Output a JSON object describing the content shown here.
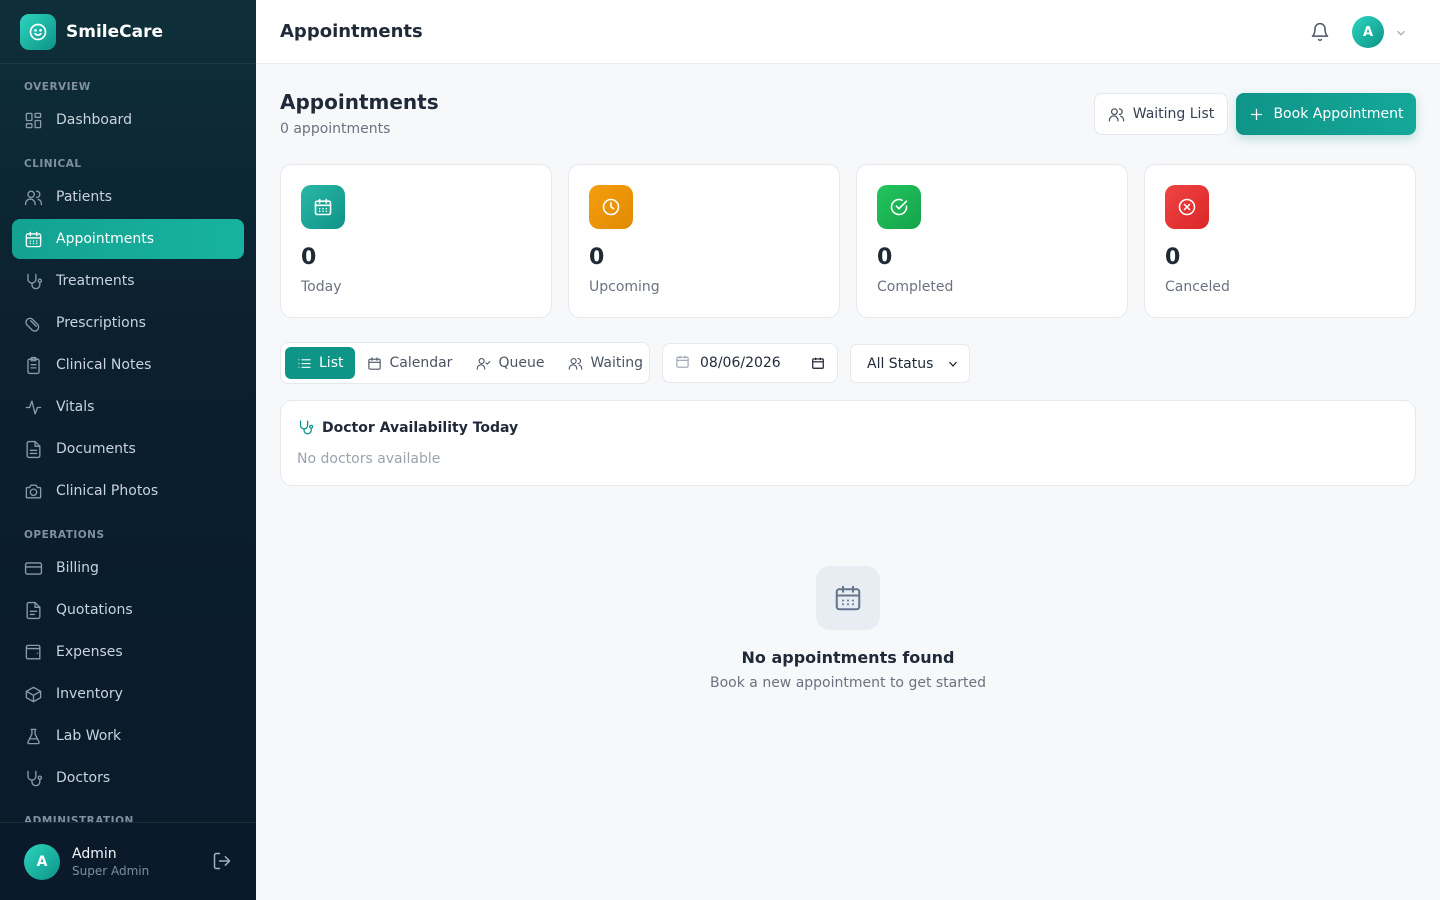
{
  "brand": {
    "name": "SmileCare"
  },
  "sidebar": {
    "sections": {
      "overview": "OVERVIEW",
      "clinical": "CLINICAL",
      "operations": "OPERATIONS",
      "administration": "ADMINISTRATION"
    },
    "items": {
      "dashboard": "Dashboard",
      "patients": "Patients",
      "appointments": "Appointments",
      "treatments": "Treatments",
      "prescriptions": "Prescriptions",
      "clinical_notes": "Clinical Notes",
      "vitals": "Vitals",
      "documents": "Documents",
      "clinical_photos": "Clinical Photos",
      "billing": "Billing",
      "quotations": "Quotations",
      "expenses": "Expenses",
      "inventory": "Inventory",
      "lab_work": "Lab Work",
      "doctors": "Doctors"
    },
    "active": "appointments",
    "user": {
      "initial": "A",
      "name": "Admin",
      "role": "Super Admin"
    }
  },
  "header": {
    "title": "Appointments",
    "avatar_initial": "A"
  },
  "main": {
    "title": "Appointments",
    "subtitle": "0 appointments",
    "waiting_list_label": "Waiting List",
    "book_label": "Book Appointment",
    "stats": [
      {
        "value": "0",
        "label": "Today",
        "color": "#14a89a"
      },
      {
        "value": "0",
        "label": "Upcoming",
        "color": "#f59e0b"
      },
      {
        "value": "0",
        "label": "Completed",
        "color": "#22c55e"
      },
      {
        "value": "0",
        "label": "Canceled",
        "color": "#ef4444"
      }
    ],
    "view_tabs": [
      "List",
      "Calendar",
      "Queue",
      "Waiting"
    ],
    "active_view": "List",
    "date_value": "08/06/2026",
    "status_filter": "All Status",
    "availability": {
      "title": "Doctor Availability Today",
      "empty": "No doctors available"
    },
    "empty_state": {
      "title": "No appointments found",
      "subtitle": "Book a new appointment to get started"
    }
  },
  "colors": {
    "accent": "#0f9488",
    "sidebar_bg": "#0b1f2e"
  }
}
